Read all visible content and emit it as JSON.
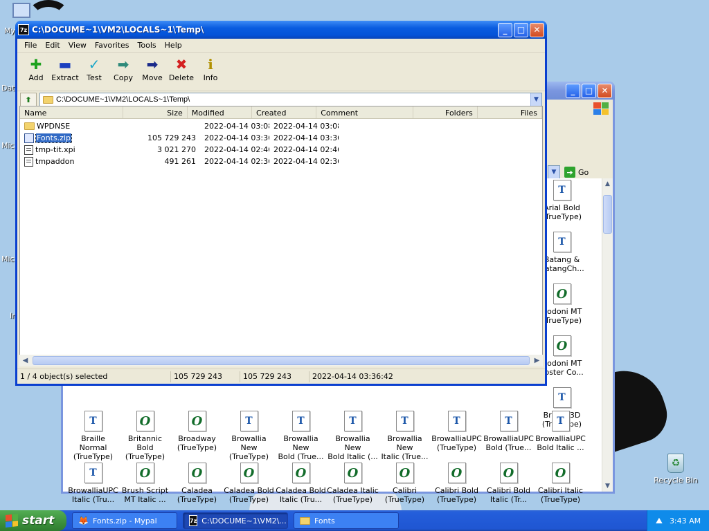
{
  "desktop": {
    "icons": [
      {
        "label": "My",
        "icon": "my-computer-icon"
      },
      {
        "label": "Dat",
        "icon": "data-icon"
      },
      {
        "label": "Micr",
        "icon": "microsoft-icon"
      },
      {
        "label": "Micr",
        "icon": "microsoft-icon"
      },
      {
        "label": "In",
        "icon": "internet-icon"
      },
      {
        "label": "Recycle Bin",
        "icon": "recycle-bin-icon"
      }
    ]
  },
  "fonts_window": {
    "go_label": "Go",
    "side_items": [
      {
        "label": "Arial Bold\n(TrueType)",
        "kind": "tt"
      },
      {
        "label": "Batang &\nBatangCh...",
        "kind": "tt"
      },
      {
        "label": "Bodoni MT\n(TrueType)",
        "kind": "ot"
      },
      {
        "label": "Bodoni MT\nPoster Co...",
        "kind": "ot"
      },
      {
        "label": "Braille 3D\n(TrueType)",
        "kind": "tt"
      }
    ],
    "row1": [
      {
        "label": "Braille Normal\n(TrueType)",
        "kind": "tt"
      },
      {
        "label": "Britannic Bold\n(TrueType)",
        "kind": "ot"
      },
      {
        "label": "Broadway\n(TrueType)",
        "kind": "ot"
      },
      {
        "label": "Browallia New\n(TrueType)",
        "kind": "tt"
      },
      {
        "label": "Browallia New\nBold (True...",
        "kind": "tt"
      },
      {
        "label": "Browallia New\nBold Italic (...",
        "kind": "tt"
      },
      {
        "label": "Browallia New\nItalic (True...",
        "kind": "tt"
      },
      {
        "label": "BrowalliaUPC\n(TrueType)",
        "kind": "tt"
      },
      {
        "label": "BrowalliaUPC\nBold (True...",
        "kind": "tt"
      },
      {
        "label": "BrowalliaUPC\nBold Italic ...",
        "kind": "tt"
      }
    ],
    "row2": [
      {
        "label": "BrowalliaUPC\nItalic (Tru...",
        "kind": "tt"
      },
      {
        "label": "Brush Script\nMT Italic ...",
        "kind": "ot"
      },
      {
        "label": "Caladea\n(TrueType)",
        "kind": "ot"
      },
      {
        "label": "Caladea Bold\n(TrueType)",
        "kind": "ot"
      },
      {
        "label": "Caladea Bold\nItalic (Tru...",
        "kind": "ot"
      },
      {
        "label": "Caladea Italic\n(TrueType)",
        "kind": "ot"
      },
      {
        "label": "Calibri\n(TrueType)",
        "kind": "ot"
      },
      {
        "label": "Calibri Bold\n(TrueType)",
        "kind": "ot"
      },
      {
        "label": "Calibri Bold\nItalic (Tr...",
        "kind": "ot"
      },
      {
        "label": "Calibri Italic\n(TrueType)",
        "kind": "ot"
      }
    ]
  },
  "zip_window": {
    "title": "C:\\DOCUME~1\\VM2\\LOCALS~1\\Temp\\",
    "app_icon_text": "7z",
    "menu": [
      "File",
      "Edit",
      "View",
      "Favorites",
      "Tools",
      "Help"
    ],
    "toolbar": [
      {
        "label": "Add",
        "icon": "add-icon",
        "glyph": "✚",
        "color": "#1fa21f"
      },
      {
        "label": "Extract",
        "icon": "extract-icon",
        "glyph": "▬",
        "color": "#1b3fbf"
      },
      {
        "label": "Test",
        "icon": "test-icon",
        "glyph": "✓",
        "color": "#1aa6c8"
      },
      {
        "label": "Copy",
        "icon": "copy-icon",
        "glyph": "➡",
        "color": "#2e8a7a"
      },
      {
        "label": "Move",
        "icon": "move-icon",
        "glyph": "➡",
        "color": "#1a2a8a"
      },
      {
        "label": "Delete",
        "icon": "delete-icon",
        "glyph": "✖",
        "color": "#d42020"
      },
      {
        "label": "Info",
        "icon": "info-icon",
        "glyph": "i",
        "color": "#b09000"
      }
    ],
    "address": "C:\\DOCUME~1\\VM2\\LOCALS~1\\Temp\\",
    "columns": [
      "Name",
      "Size",
      "Modified",
      "Created",
      "Comment",
      "Folders",
      "Files"
    ],
    "rows": [
      {
        "name": "WPDNSE",
        "type": "folder",
        "size": "",
        "modified": "2022-04-14 03:08",
        "created": "2022-04-14 03:08"
      },
      {
        "name": "Fonts.zip",
        "type": "zip",
        "size": "105 729 243",
        "modified": "2022-04-14 03:36",
        "created": "2022-04-14 03:36",
        "selected": true
      },
      {
        "name": "tmp-tit.xpi",
        "type": "file",
        "size": "3 021 270",
        "modified": "2022-04-14 02:46",
        "created": "2022-04-14 02:46"
      },
      {
        "name": "tmpaddon",
        "type": "file",
        "size": "491 261",
        "modified": "2022-04-14 02:36",
        "created": "2022-04-14 02:36"
      }
    ],
    "status": {
      "selection": "1 / 4 object(s) selected",
      "size": "105 729 243",
      "packed": "105 729 243",
      "time": "2022-04-14 03:36:42"
    }
  },
  "taskbar": {
    "start_label": "start",
    "tasks": [
      {
        "label": "Fonts.zip - Mypal",
        "icon": "mypal-icon"
      },
      {
        "label": "C:\\DOCUME~1\\VM2\\...",
        "icon": "7zip-icon",
        "active": true
      },
      {
        "label": "Fonts",
        "icon": "folder-icon"
      }
    ],
    "clock": "3:43 AM"
  }
}
